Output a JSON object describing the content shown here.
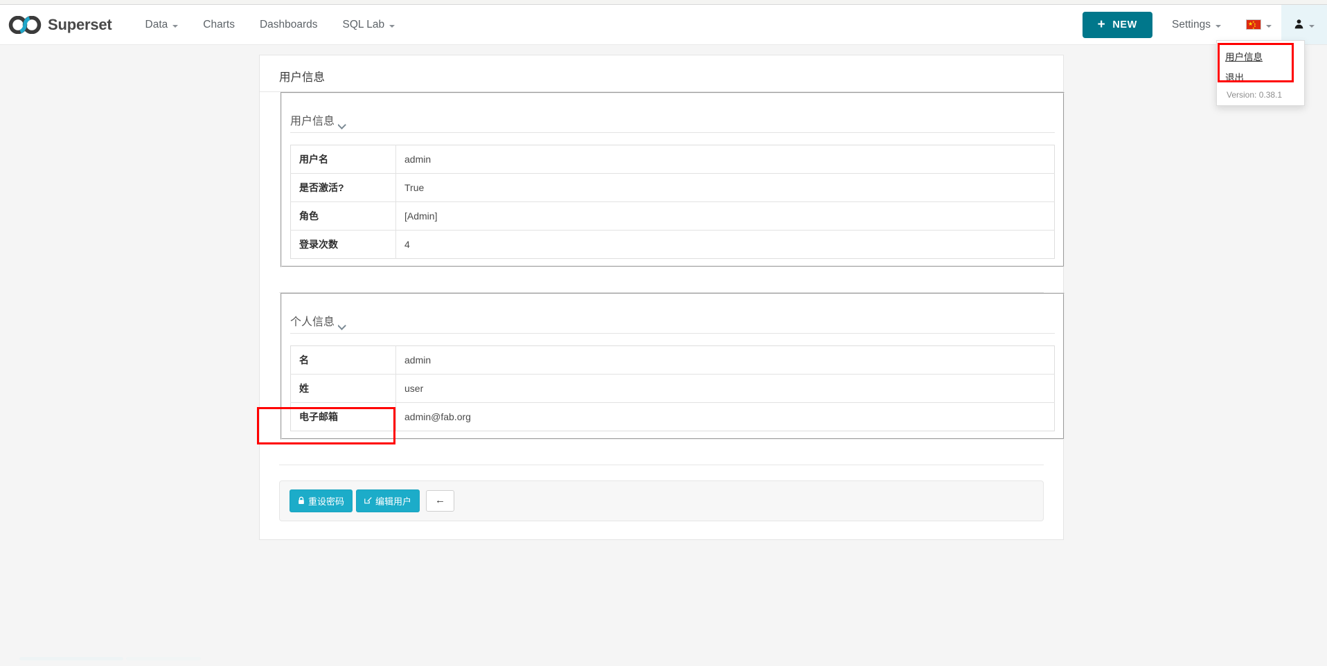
{
  "navbar": {
    "brand_label": "Superset",
    "brand_icon": "superset-infinity-logo",
    "items": [
      {
        "label": "Data",
        "has_caret": true
      },
      {
        "label": "Charts",
        "has_caret": false
      },
      {
        "label": "Dashboards",
        "has_caret": false
      },
      {
        "label": "SQL Lab",
        "has_caret": true
      }
    ],
    "new_button": {
      "label": "NEW",
      "plus": "+",
      "color": "#00778b"
    },
    "settings": {
      "label": "Settings",
      "has_caret": true
    },
    "language": {
      "icon": "china-flag-icon",
      "has_caret": true
    },
    "user": {
      "icon": "user-avatar-icon",
      "glyph": "&#128100;",
      "has_caret": true
    }
  },
  "user_dropdown": {
    "items": [
      {
        "label": "用户信息"
      },
      {
        "label": "退出"
      }
    ],
    "version": "Version: 0.38.1",
    "highlight_color": "#ff0000"
  },
  "panel": {
    "title": "用户信息",
    "sections": [
      {
        "legend": "用户信息",
        "rows": [
          {
            "label": "用户名",
            "value": "admin"
          },
          {
            "label": "是否激活?",
            "value": "True"
          },
          {
            "label": "角色",
            "value": "[Admin]"
          },
          {
            "label": "登录次数",
            "value": "4"
          }
        ]
      },
      {
        "legend": "个人信息",
        "rows": [
          {
            "label": "名",
            "value": "admin"
          },
          {
            "label": "姓",
            "value": "user"
          },
          {
            "label": "电子邮箱",
            "value": "admin@fab.org"
          }
        ]
      }
    ]
  },
  "footer": {
    "reset_password_button": {
      "label": "重设密码",
      "icon": "lock-icon",
      "glyph": "🔒"
    },
    "edit_user_button": {
      "label": "编辑用户",
      "icon": "edit-pencil-icon",
      "glyph": "✎"
    },
    "back_button": {
      "label": "←",
      "icon": "arrow-left-icon"
    },
    "button_color": "#1cacc9",
    "highlight_color": "#ff0000"
  }
}
